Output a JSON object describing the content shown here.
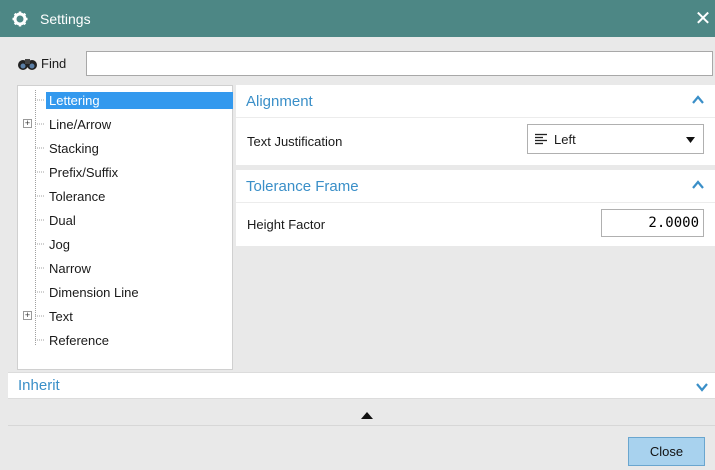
{
  "window": {
    "title": "Settings",
    "close_glyph": "✕"
  },
  "find": {
    "label": "Find",
    "value": "",
    "icon": "binoculars-icon"
  },
  "tree": {
    "items": [
      {
        "label": "Lettering",
        "selected": true,
        "expandable": false
      },
      {
        "label": "Line/Arrow",
        "selected": false,
        "expandable": true
      },
      {
        "label": "Stacking",
        "selected": false,
        "expandable": false
      },
      {
        "label": "Prefix/Suffix",
        "selected": false,
        "expandable": false
      },
      {
        "label": "Tolerance",
        "selected": false,
        "expandable": false
      },
      {
        "label": "Dual",
        "selected": false,
        "expandable": false
      },
      {
        "label": "Jog",
        "selected": false,
        "expandable": false
      },
      {
        "label": "Narrow",
        "selected": false,
        "expandable": false
      },
      {
        "label": "Dimension Line",
        "selected": false,
        "expandable": false
      },
      {
        "label": "Text",
        "selected": false,
        "expandable": true
      },
      {
        "label": "Reference",
        "selected": false,
        "expandable": false
      }
    ],
    "expander_glyph": "+"
  },
  "alignment": {
    "title": "Alignment",
    "text_justification_label": "Text Justification",
    "text_justification_value": "Left",
    "options": [
      "Left"
    ]
  },
  "tolerance_frame": {
    "title": "Tolerance Frame",
    "height_factor_label": "Height Factor",
    "height_factor_value": "2.0000"
  },
  "inherit": {
    "title": "Inherit"
  },
  "buttons": {
    "close": "Close"
  },
  "colors": {
    "titlebar": "#4d8785",
    "accent": "#3a8fc8",
    "selection": "#3399ee",
    "close_button": "#a8d2ee"
  }
}
